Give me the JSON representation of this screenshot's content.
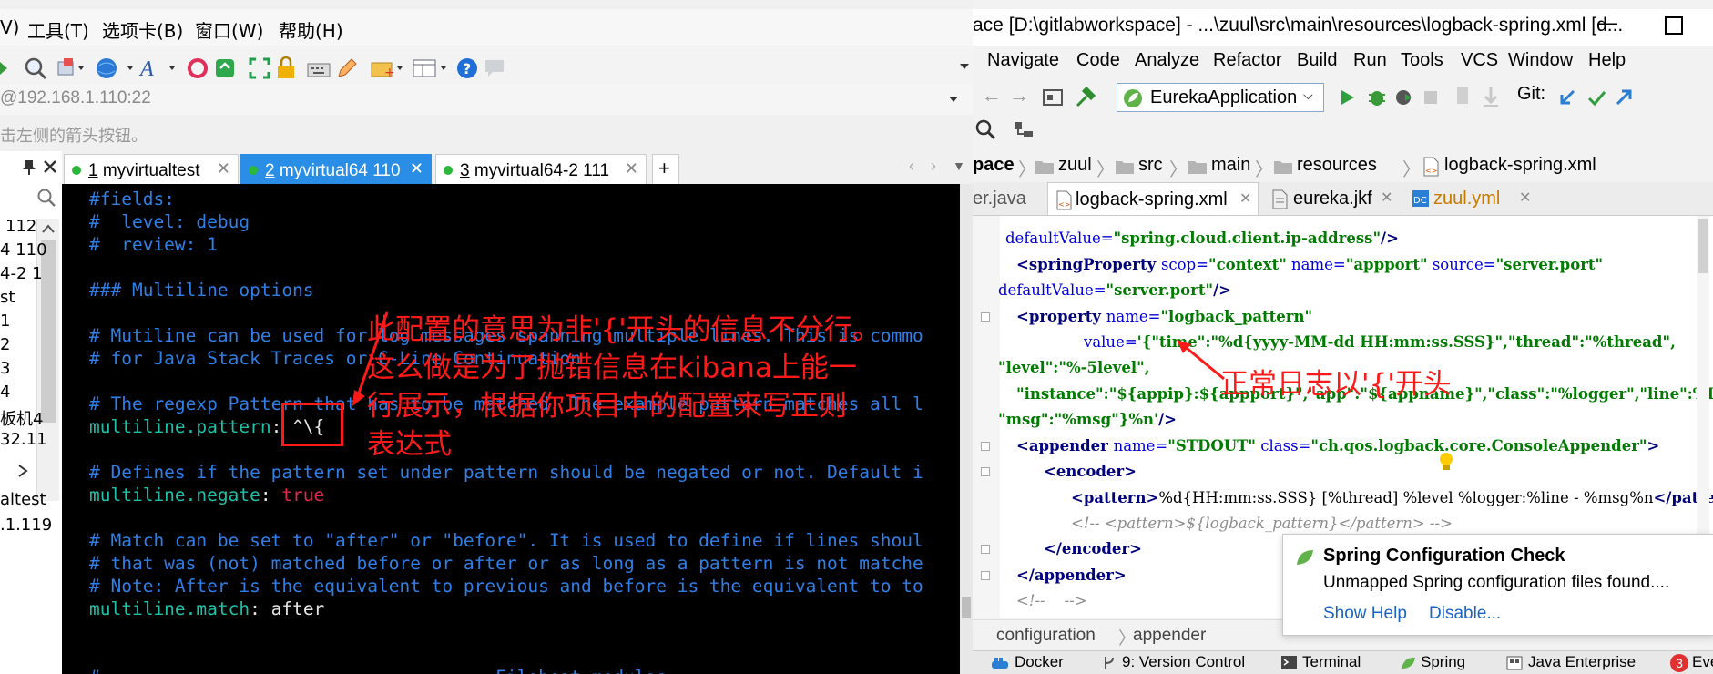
{
  "left_window": {
    "menu": [
      "V)",
      "工具(T)",
      "选项卡(B)",
      "窗口(W)",
      "帮助(H)"
    ],
    "address": "@192.168.1.110:22",
    "hint": "击左侧的箭头按钮。",
    "panel_items": [
      "112",
      "4 110",
      "4-2 1",
      "st",
      "1",
      "2",
      "3",
      "4",
      "板机4",
      "32.11",
      "altest",
      ".1.119"
    ],
    "tabs": [
      {
        "num": "1",
        "label": " myvirtualtest"
      },
      {
        "num": "2",
        "label": " myvirtual64 110"
      },
      {
        "num": "3",
        "label": " myvirtual64-2 111"
      }
    ],
    "add_tab": "+",
    "terminal_lines": [
      {
        "kind": "c",
        "text": "#fields:"
      },
      {
        "kind": "c",
        "text": "#  level: debug"
      },
      {
        "kind": "c",
        "text": "#  review: 1"
      },
      {
        "kind": "c",
        "text": "### Multiline options"
      },
      {
        "kind": "c",
        "text": "# Mutiline can be used for log messages spanning multiple lines. This is commo"
      },
      {
        "kind": "c",
        "text": "# for Java Stack Traces or C-Line Continuation"
      },
      {
        "kind": "c",
        "text": "# The regexp Pattern that has to be matched. The example pattern matches all l"
      },
      {
        "kind": "kv",
        "key": "multiline.pattern",
        "sep": ": ",
        "value": "^\\{",
        "vclass": "val-white"
      },
      {
        "kind": "c",
        "text": "# Defines if the pattern set under pattern should be negated or not. Default i"
      },
      {
        "kind": "kv",
        "key": "multiline.negate",
        "sep": ": ",
        "value": "true",
        "vclass": "val-red"
      },
      {
        "kind": "c",
        "text": "# Match can be set to \"after\" or \"before\". It is used to define if lines shoul"
      },
      {
        "kind": "c",
        "text": "# that was (not) matched before or after or as long as a pattern is not matche"
      },
      {
        "kind": "c",
        "text": "# Note: After is the equivalent to previous and before is the equivalent to to"
      },
      {
        "kind": "kv",
        "key": "multiline.match",
        "sep": ": ",
        "value": "after",
        "vclass": "val-white"
      },
      {
        "kind": "c",
        "text": "#==================================== Filebeat modules ========================"
      }
    ]
  },
  "annotations": {
    "a1": "此配置的意思为非'{'开头的信息不分行。",
    "a2": "这么做是为了抛错信息在kibana上能一",
    "a3": "行展示，根据你项目中的配置来写正则",
    "a4": "表达式",
    "a5": "正常日志以'{'开头"
  },
  "ide": {
    "title": "ace [D:\\gitlabworkspace] - ...\\zuul\\src\\main\\resources\\logback-spring.xml [d...",
    "menu": [
      "Navigate",
      "Code",
      "Analyze",
      "Refactor",
      "Build",
      "Run",
      "Tools",
      "VCS",
      "Window",
      "Help"
    ],
    "run_config": "EurekaApplication",
    "git_label": "Git:",
    "breadcrumb": [
      "pace",
      "zuul",
      "src",
      "main",
      "resources",
      "logback-spring.xml"
    ],
    "editor_tabs": [
      "er.java",
      "logback-spring.xml",
      "eureka.jkf",
      "zuul.yml"
    ],
    "code_lines": [
      [
        [
          "at",
          "defaultValue="
        ],
        [
          "sv",
          "\"spring.cloud.client.ip-address\""
        ],
        [
          "tg",
          "/>"
        ]
      ],
      [
        [
          "tg",
          "<springProperty "
        ],
        [
          "at",
          "scop="
        ],
        [
          "sv",
          "\"context\""
        ],
        [
          "at",
          " name="
        ],
        [
          "sv",
          "\"appport\""
        ],
        [
          "at",
          " source="
        ],
        [
          "sv",
          "\"server.port\""
        ]
      ],
      [
        [
          "at",
          "defaultValue="
        ],
        [
          "sv",
          "\"server.port\""
        ],
        [
          "tg",
          "/>"
        ]
      ],
      [
        [
          "tg",
          "<property "
        ],
        [
          "at",
          "name="
        ],
        [
          "sv",
          "\"logback_pattern\""
        ]
      ],
      [
        [
          "at",
          "value="
        ],
        [
          "sv",
          "'{\"time\":\"%d{yyyy-MM-dd HH:mm:ss.SSS}\",\"thread\":\"%thread\","
        ]
      ],
      [
        [
          "sv",
          "\"level\":\"%-5level\","
        ]
      ],
      [
        [
          "sv",
          "\"instance\":\"${appip}:${appport}\",\"app\":\"${appname}\",\"class\":\"%logger\",\"line\":%L,"
        ]
      ],
      [
        [
          "sv",
          "\"msg\":\"%msg\"}%n'"
        ],
        [
          "tg",
          "/>"
        ]
      ],
      [
        [
          "tg",
          "<appender "
        ],
        [
          "at",
          "name="
        ],
        [
          "sv",
          "\"STDOUT\""
        ],
        [
          "at",
          " class="
        ],
        [
          "sv",
          "\"ch.qos.logback.core.ConsoleAppender\""
        ],
        [
          "tg",
          ">"
        ]
      ],
      [
        [
          "tg",
          "<encoder>"
        ]
      ],
      [
        [
          "tg",
          "<pattern>"
        ],
        [
          "tx",
          "%d{HH:mm:ss.SSS} [%thread] %level %logger:%line - %msg%n"
        ],
        [
          "tg",
          "</pattern>"
        ]
      ],
      [
        [
          "cm",
          "<!-- <pattern>${logback_pattern}</pattern> -->"
        ]
      ],
      [
        [
          "tg",
          "</encoder>"
        ]
      ],
      [
        [
          "tg",
          "</appender>"
        ]
      ],
      [
        [
          "cm",
          "<!--    -->"
        ]
      ]
    ],
    "nav": [
      "configuration",
      "appender"
    ],
    "bottom_tabs": [
      "Docker",
      "9: Version Control",
      "Terminal",
      "Spring",
      "Java Enterprise",
      "Eve"
    ],
    "bottom_badge": "3",
    "notification": {
      "title": "Spring Configuration Check",
      "body": "Unmapped Spring configuration files found....",
      "link1": "Show Help",
      "link2": "Disable..."
    }
  },
  "colors": {
    "terminal_bg": "#000000",
    "comment_blue": "#2f7fe6",
    "key_cyan": "#1fbfa8",
    "annotation_red": "#ff1a1a",
    "tab_active": "#2a8ee6"
  }
}
